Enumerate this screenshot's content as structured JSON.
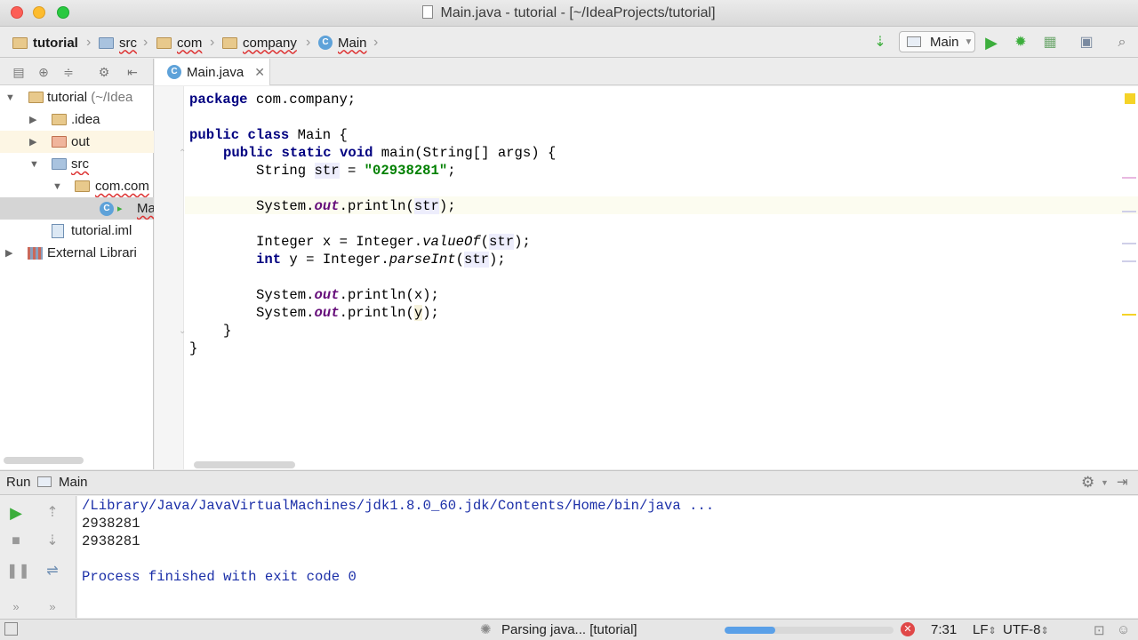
{
  "window": {
    "title": "Main.java - tutorial - [~/IdeaProjects/tutorial]"
  },
  "breadcrumb": {
    "items": [
      "tutorial",
      "src",
      "com",
      "company",
      "Main"
    ]
  },
  "toolbar": {
    "run_config": "Main"
  },
  "project": {
    "tree": [
      {
        "label": "tutorial",
        "suffix": "(~/Idea",
        "level": 0,
        "expanded": true
      },
      {
        "label": ".idea",
        "level": 1,
        "expanded": false
      },
      {
        "label": "out",
        "level": 1,
        "expanded": false
      },
      {
        "label": "src",
        "level": 1,
        "expanded": true
      },
      {
        "label": "com.com",
        "level": 2,
        "expanded": true
      },
      {
        "label": "Ma",
        "level": 3,
        "selected": true
      },
      {
        "label": "tutorial.iml",
        "level": 1
      },
      {
        "label": "External Librari",
        "level": 0,
        "expanded": false
      }
    ]
  },
  "editor": {
    "tab_label": "Main.java",
    "lines": {
      "l1a": "package",
      "l1b": " com.company;",
      "l3a": "public class",
      "l3b": " Main {",
      "l4a": "public static void",
      "l4b": " main(String[] args) {",
      "l5a": "String ",
      "l5b": "str",
      "l5c": " = ",
      "l5d": "\"02938281\"",
      "l5e": ";",
      "l7a": "System.",
      "l7b": "out",
      "l7c": ".println(",
      "l7d": "str",
      "l7e": ");",
      "l9a": "Integer x = Integer.",
      "l9b": "valueOf",
      "l9c": "(",
      "l9d": "str",
      "l9e": ");",
      "l10a": "int",
      "l10b": " y = Integer.",
      "l10c": "parseInt",
      "l10d": "(",
      "l10e": "str",
      "l10f": ");",
      "l12a": "System.",
      "l12b": "out",
      "l12c": ".println(x);",
      "l13a": "System.",
      "l13b": "out",
      "l13c": ".println(",
      "l13d": "y",
      "l13e": ");",
      "l14": "}",
      "l15": "}"
    }
  },
  "run": {
    "tab_label": "Run",
    "config_label": "Main",
    "console": [
      "/Library/Java/JavaVirtualMachines/jdk1.8.0_60.jdk/Contents/Home/bin/java ...",
      "2938281",
      "2938281",
      "",
      "Process finished with exit code 0"
    ]
  },
  "statusbar": {
    "task": "Parsing java... [tutorial]",
    "progress": 0.3,
    "position": "7:31",
    "line_sep": "LF",
    "encoding": "UTF-8"
  },
  "colors": {
    "accent": "#5aa0e8",
    "keyword": "#000080",
    "string": "#008000",
    "field": "#660e7a",
    "console_blue": "#1b2fa8",
    "run_green": "#3cae3c"
  }
}
